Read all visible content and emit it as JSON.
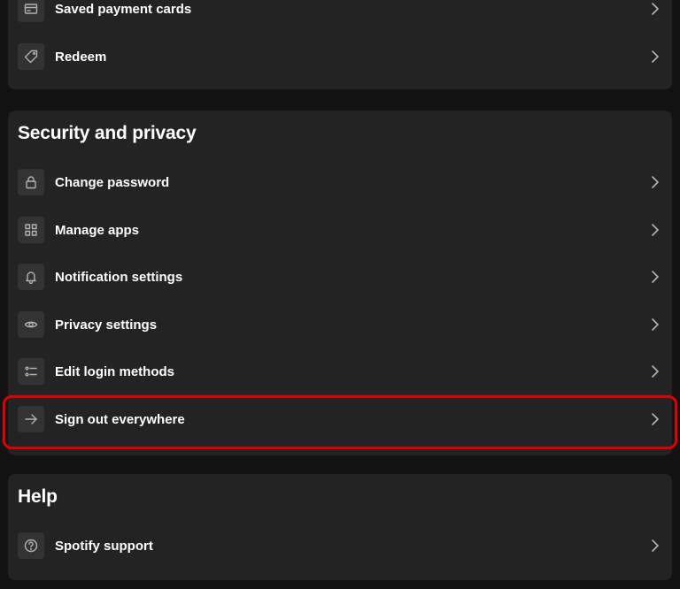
{
  "payment_section": {
    "items": [
      {
        "label": "Saved payment cards",
        "icon": "card-icon"
      },
      {
        "label": "Redeem",
        "icon": "tag-icon"
      }
    ]
  },
  "security_section": {
    "title": "Security and privacy",
    "items": [
      {
        "label": "Change password",
        "icon": "lock-icon"
      },
      {
        "label": "Manage apps",
        "icon": "grid-icon"
      },
      {
        "label": "Notification settings",
        "icon": "bell-icon"
      },
      {
        "label": "Privacy settings",
        "icon": "eye-icon"
      },
      {
        "label": "Edit login methods",
        "icon": "list-icon"
      },
      {
        "label": "Sign out everywhere",
        "icon": "arrow-right-icon"
      }
    ]
  },
  "help_section": {
    "title": "Help",
    "items": [
      {
        "label": "Spotify support",
        "icon": "help-circle-icon"
      }
    ]
  },
  "colors": {
    "background": "#121212",
    "card": "#232323",
    "icon_box": "#333333",
    "highlight": "#e00000"
  }
}
